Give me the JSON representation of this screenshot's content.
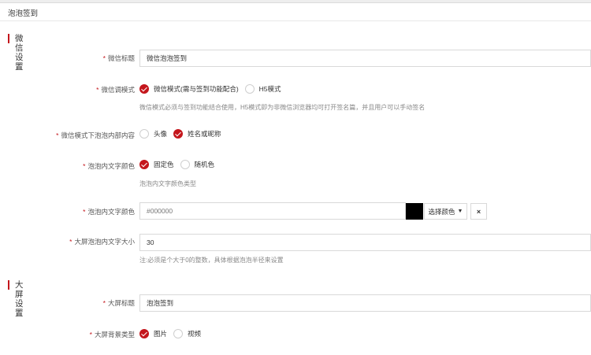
{
  "page": {
    "title": "泡泡签到"
  },
  "sections": {
    "wechat": "微信设置",
    "screen": "大屏设置"
  },
  "fields": {
    "wx_title": {
      "required": "*",
      "label": "微信标题",
      "value": "微信泡泡签到"
    },
    "wx_mode": {
      "required": "*",
      "label": "微信调模式",
      "options": [
        "微信模式(需与签到功能配合)",
        "H5模式"
      ],
      "selected": 0,
      "help": "微信模式必须与签到功能结合使用，H5模式即为非微信浏览器均可打开签名篇，并且用户可以手动签名"
    },
    "bubble_content": {
      "required": "*",
      "label": "微信模式下泡泡内部内容",
      "options": [
        "头像",
        "姓名或昵称"
      ],
      "selected": 1
    },
    "text_color_mode": {
      "required": "*",
      "label": "泡泡内文字颜色",
      "options": [
        "固定色",
        "随机色"
      ],
      "selected": 0,
      "help": "泡泡内文字颜色类型"
    },
    "text_color": {
      "required": "*",
      "label": "泡泡内文字颜色",
      "value": "#000000",
      "swatch": "#000000",
      "pick_label": "选择颜色",
      "clear_label": "×"
    },
    "font_size": {
      "required": "*",
      "label": "大屏泡泡内文字大小",
      "value": "30",
      "help": "注:必须是个大于0的整数，具体根据泡泡半径来设置"
    },
    "screen_title": {
      "required": "*",
      "label": "大屏标题",
      "value": "泡泡签到"
    },
    "bg_type": {
      "required": "*",
      "label": "大屏背景类型",
      "options": [
        "图片",
        "视频"
      ],
      "selected": 0
    }
  },
  "colors": {
    "accent": "#c4161c",
    "border": "#d9d9d9",
    "help_text": "#888888"
  }
}
